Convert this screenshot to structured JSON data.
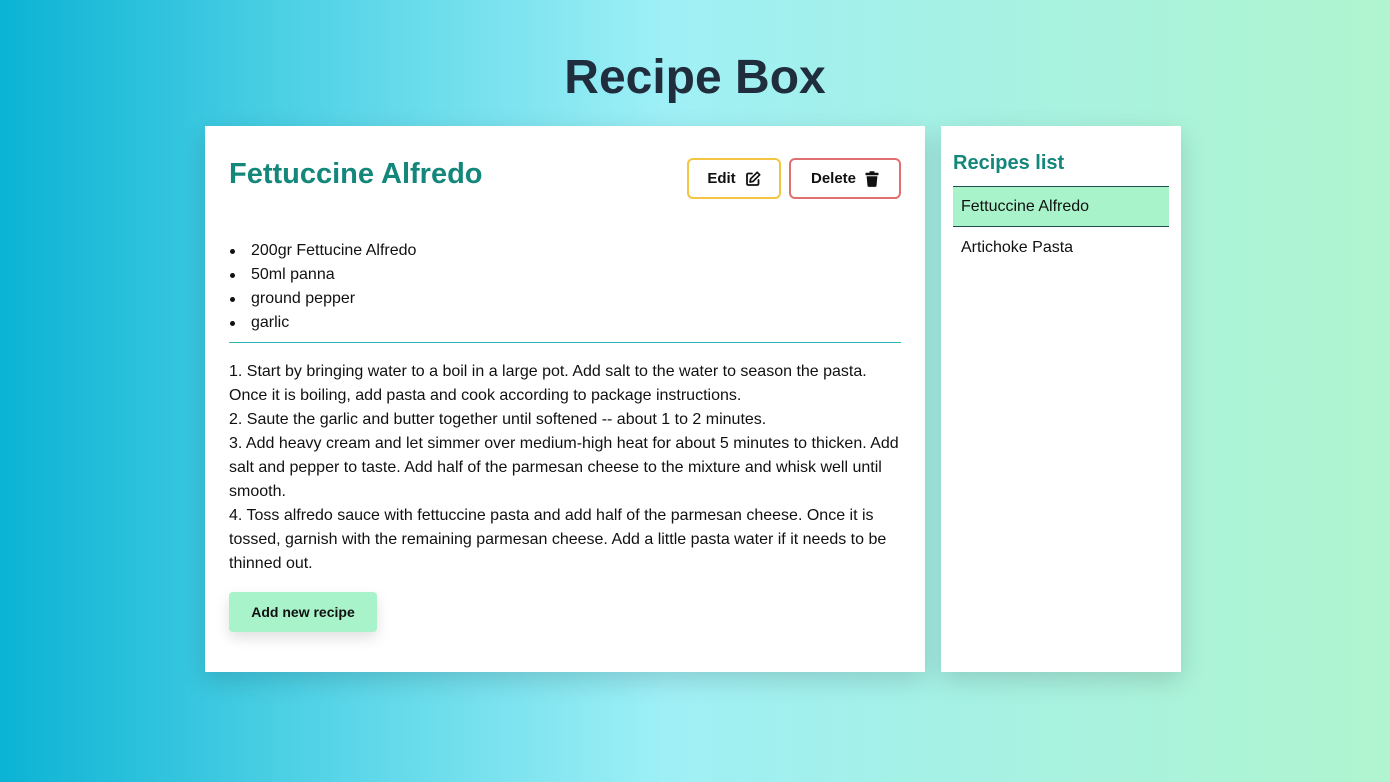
{
  "app": {
    "title": "Recipe Box"
  },
  "recipe": {
    "title": "Fettuccine Alfredo",
    "edit_label": "Edit",
    "delete_label": "Delete",
    "ingredients": [
      "200gr Fettucine Alfredo",
      "50ml panna",
      "ground pepper",
      "garlic"
    ],
    "instructions": [
      "1. Start by bringing water to a boil in a large pot. Add salt to the water to season the pasta. Once it is boiling, add pasta and cook according to package instructions.",
      "2. Saute the garlic and butter together until softened -- about 1 to 2 minutes.",
      "3. Add heavy cream and let simmer over medium-high heat for about 5 minutes to thicken. Add salt and pepper to taste. Add half of the parmesan cheese to the mixture and whisk well until smooth.",
      "4. Toss alfredo sauce with fettuccine pasta and add half of the parmesan cheese. Once it is tossed, garnish with the remaining parmesan cheese. Add a little pasta water if it needs to be thinned out."
    ],
    "add_label": "Add new recipe"
  },
  "sidebar": {
    "title": "Recipes list",
    "items": [
      {
        "label": "Fettuccine Alfredo",
        "active": true
      },
      {
        "label": "Artichoke Pasta",
        "active": false
      }
    ]
  },
  "icons": {
    "edit": "edit-icon",
    "delete": "trash-icon"
  },
  "colors": {
    "accent": "#14877b",
    "edit_border": "#f4c542",
    "delete_border": "#e07070",
    "add_button": "#a8f3c9",
    "active_item": "#a8f3c9"
  }
}
